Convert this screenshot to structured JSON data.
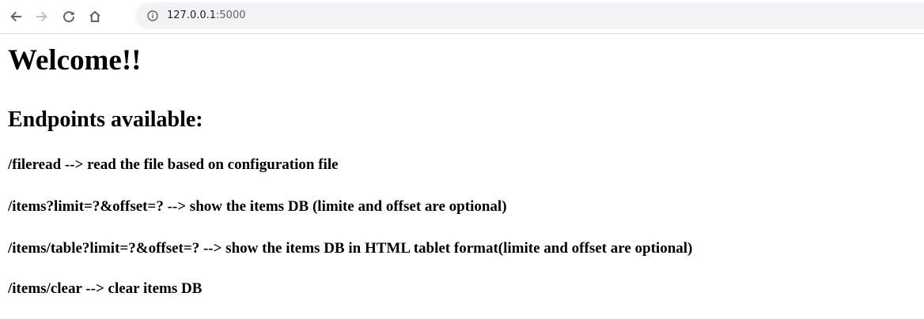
{
  "browser": {
    "url_host": "127.0.0.1",
    "url_port": ":5000"
  },
  "page": {
    "title": "Welcome!!",
    "subtitle": "Endpoints available:",
    "endpoints": [
      "/fileread --> read the file based on configuration file",
      "/items?limit=?&offset=? --> show the items DB (limite and offset are optional)",
      "/items/table?limit=?&offset=? --> show the items DB in HTML tablet format(limite and offset are optional)",
      "/items/clear --> clear items DB"
    ]
  },
  "colors": {
    "toolbar_icon": "#5f6368",
    "omnibox_bg": "#f1f3f4",
    "text": "#000000"
  }
}
